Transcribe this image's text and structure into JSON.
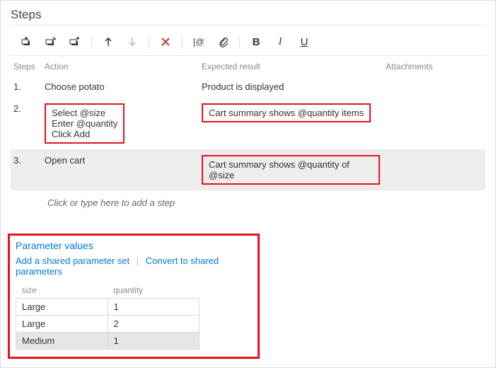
{
  "panel": {
    "title": "Steps"
  },
  "toolbar": {
    "insertStep": "Insert step",
    "insertShared": "Insert shared steps",
    "createShared": "Create shared steps",
    "moveUp": "Move up",
    "moveDown": "Move down",
    "delete": "Delete",
    "insertParam": "@",
    "attach": "Attach",
    "bold": "B",
    "italic": "I",
    "underline": "U"
  },
  "columns": {
    "steps": "Steps",
    "action": "Action",
    "expected": "Expected result",
    "attachments": "Attachments"
  },
  "rows": [
    {
      "num": "1.",
      "action": "Choose potato",
      "expected": "Product is displayed",
      "highlightAction": false,
      "highlightExpected": false,
      "selected": false
    },
    {
      "num": "2.",
      "action": "Select @size\nEnter @quantity\nClick Add",
      "expected": "Cart summary shows @quantity items",
      "highlightAction": true,
      "highlightExpected": true,
      "selected": false
    },
    {
      "num": "3.",
      "action": "Open cart",
      "expected": "Cart summary shows @quantity of @size",
      "highlightAction": false,
      "highlightExpected": true,
      "selected": true
    }
  ],
  "placeholder": "Click or type here to add a step",
  "params": {
    "title": "Parameter values",
    "addShared": "Add a shared parameter set",
    "convert": "Convert to shared parameters",
    "headers": [
      "size",
      "quantity"
    ],
    "rows": [
      {
        "size": "Large",
        "quantity": "1",
        "selected": false
      },
      {
        "size": "Large",
        "quantity": "2",
        "selected": false
      },
      {
        "size": "Medium",
        "quantity": "1",
        "selected": true
      }
    ]
  }
}
